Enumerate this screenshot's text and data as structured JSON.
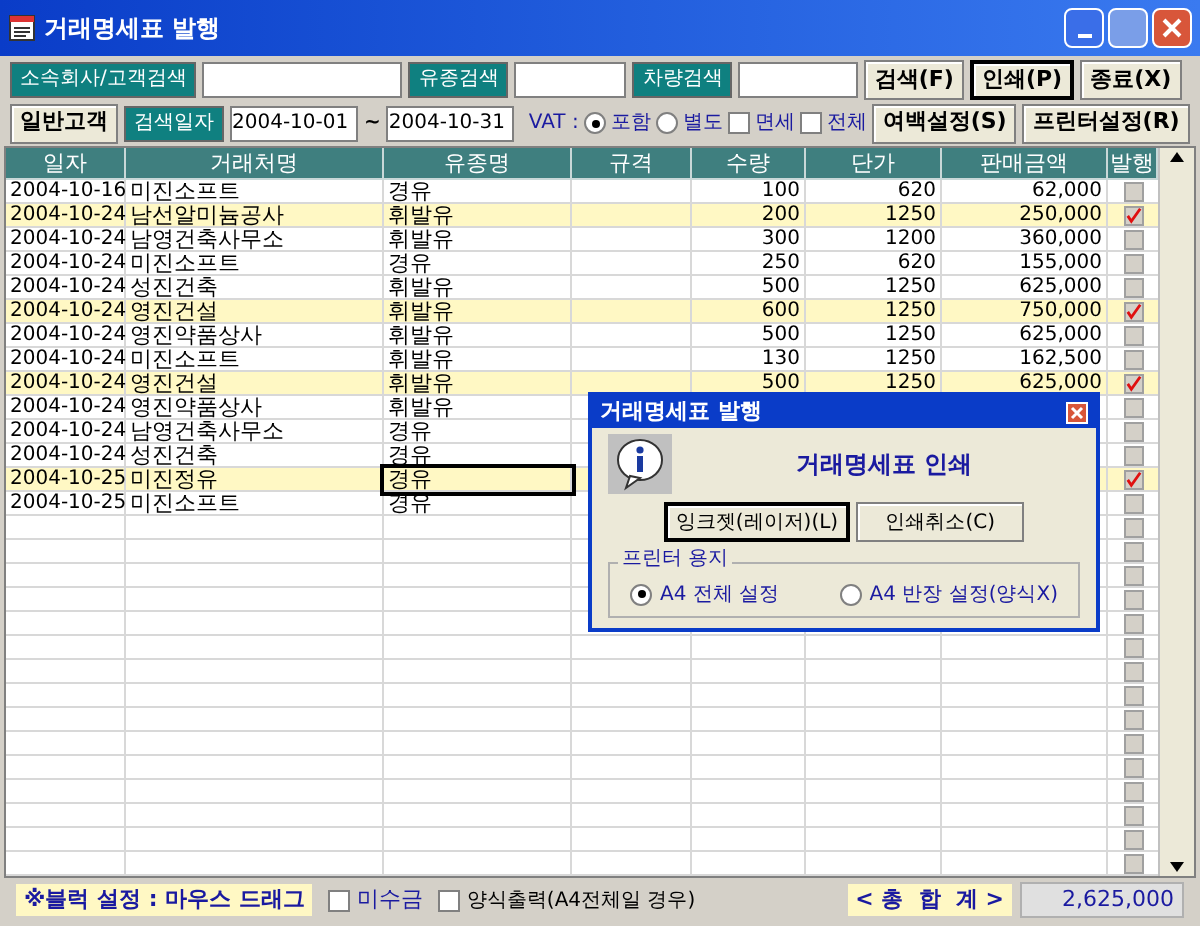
{
  "window": {
    "title": "거래명세표 발행"
  },
  "search_row": {
    "fields": [
      {
        "label": "소속회사/고객검색"
      },
      {
        "label": "유종검색"
      },
      {
        "label": "차량검색"
      }
    ],
    "buttons": [
      {
        "label": "검색(F)",
        "focused": false
      },
      {
        "label": "인쇄(P)",
        "focused": true
      },
      {
        "label": "종료(X)",
        "focused": false
      }
    ]
  },
  "filter_row": {
    "customer_button": "일반고객",
    "date_label": "검색일자",
    "date_from": "2004-10-01",
    "tilde": "~",
    "date_to": "2004-10-31",
    "vat_label": "VAT :",
    "vat_options": [
      {
        "label": "포함",
        "selected": true
      },
      {
        "label": "별도",
        "selected": false
      }
    ],
    "checks": [
      {
        "label": "면세",
        "checked": false
      },
      {
        "label": "전체",
        "checked": false
      }
    ],
    "buttons": [
      "여백설정(S)",
      "프린터설정(R)"
    ]
  },
  "table": {
    "columns": [
      "일자",
      "거래처명",
      "유종명",
      "규격",
      "수량",
      "단가",
      "판매금액",
      "발행"
    ],
    "rows": [
      {
        "date": "2004-10-16",
        "client": "미진소프트",
        "fuel": "경유",
        "qty": "100",
        "price": "620",
        "amount": "62,000",
        "issued": false,
        "focused": false
      },
      {
        "date": "2004-10-24",
        "client": "남선알미늄공사",
        "fuel": "휘발유",
        "qty": "200",
        "price": "1250",
        "amount": "250,000",
        "issued": true,
        "focused": false
      },
      {
        "date": "2004-10-24",
        "client": "남영건축사무소",
        "fuel": "휘발유",
        "qty": "300",
        "price": "1200",
        "amount": "360,000",
        "issued": false,
        "focused": false
      },
      {
        "date": "2004-10-24",
        "client": "미진소프트",
        "fuel": "경유",
        "qty": "250",
        "price": "620",
        "amount": "155,000",
        "issued": false,
        "focused": false
      },
      {
        "date": "2004-10-24",
        "client": "성진건축",
        "fuel": "휘발유",
        "qty": "500",
        "price": "1250",
        "amount": "625,000",
        "issued": false,
        "focused": false
      },
      {
        "date": "2004-10-24",
        "client": "영진건설",
        "fuel": "휘발유",
        "qty": "600",
        "price": "1250",
        "amount": "750,000",
        "issued": true,
        "focused": false
      },
      {
        "date": "2004-10-24",
        "client": "영진약품상사",
        "fuel": "휘발유",
        "qty": "500",
        "price": "1250",
        "amount": "625,000",
        "issued": false,
        "focused": false
      },
      {
        "date": "2004-10-24",
        "client": "미진소프트",
        "fuel": "휘발유",
        "qty": "130",
        "price": "1250",
        "amount": "162,500",
        "issued": false,
        "focused": false
      },
      {
        "date": "2004-10-24",
        "client": "영진건설",
        "fuel": "휘발유",
        "qty": "500",
        "price": "1250",
        "amount": "625,000",
        "issued": true,
        "focused": false
      },
      {
        "date": "2004-10-24",
        "client": "영진약품상사",
        "fuel": "휘발유",
        "issued": false,
        "focused": false
      },
      {
        "date": "2004-10-24",
        "client": "남영건축사무소",
        "fuel": "경유",
        "issued": false,
        "focused": false
      },
      {
        "date": "2004-10-24",
        "client": "성진건축",
        "fuel": "경유",
        "issued": false,
        "focused": false
      },
      {
        "date": "2004-10-25",
        "client": "미진정유",
        "fuel": "경유",
        "issued": true,
        "focused": true
      },
      {
        "date": "2004-10-25",
        "client": "미진소프트",
        "fuel": "경유",
        "issued": false,
        "focused": false
      }
    ],
    "blank_rows": [
      {
        "issued": false
      },
      {
        "issued": false
      },
      {
        "issued": false
      },
      {
        "issued": false
      },
      {
        "issued": false
      },
      {
        "issued": false
      },
      {
        "issued": false
      },
      {
        "issued": false
      },
      {
        "issued": false
      },
      {
        "issued": false
      },
      {
        "issued": false
      },
      {
        "issued": false
      },
      {
        "issued": false
      },
      {
        "issued": false
      },
      {
        "issued": false
      }
    ]
  },
  "footer": {
    "hint": "※블럭 설정 : 마우스 드래그",
    "checks": [
      {
        "label": "미수금",
        "checked": false
      },
      {
        "label": "양식출력(A4전체일 경우)",
        "checked": false
      }
    ],
    "total_label": "< 총  합  계 >",
    "total": "2,625,000"
  },
  "dialog": {
    "title": "거래명세표 발행",
    "heading": "거래명세표 인쇄",
    "buttons": [
      {
        "label": "잉크젯(레이저)(L)",
        "focused": true
      },
      {
        "label": "인쇄취소(C)",
        "focused": false
      }
    ],
    "group_label": "프린터 용지",
    "options": [
      {
        "label": "A4 전체 설정",
        "selected": true
      },
      {
        "label": "A4 반장 설정(양식X)",
        "selected": false
      }
    ]
  }
}
